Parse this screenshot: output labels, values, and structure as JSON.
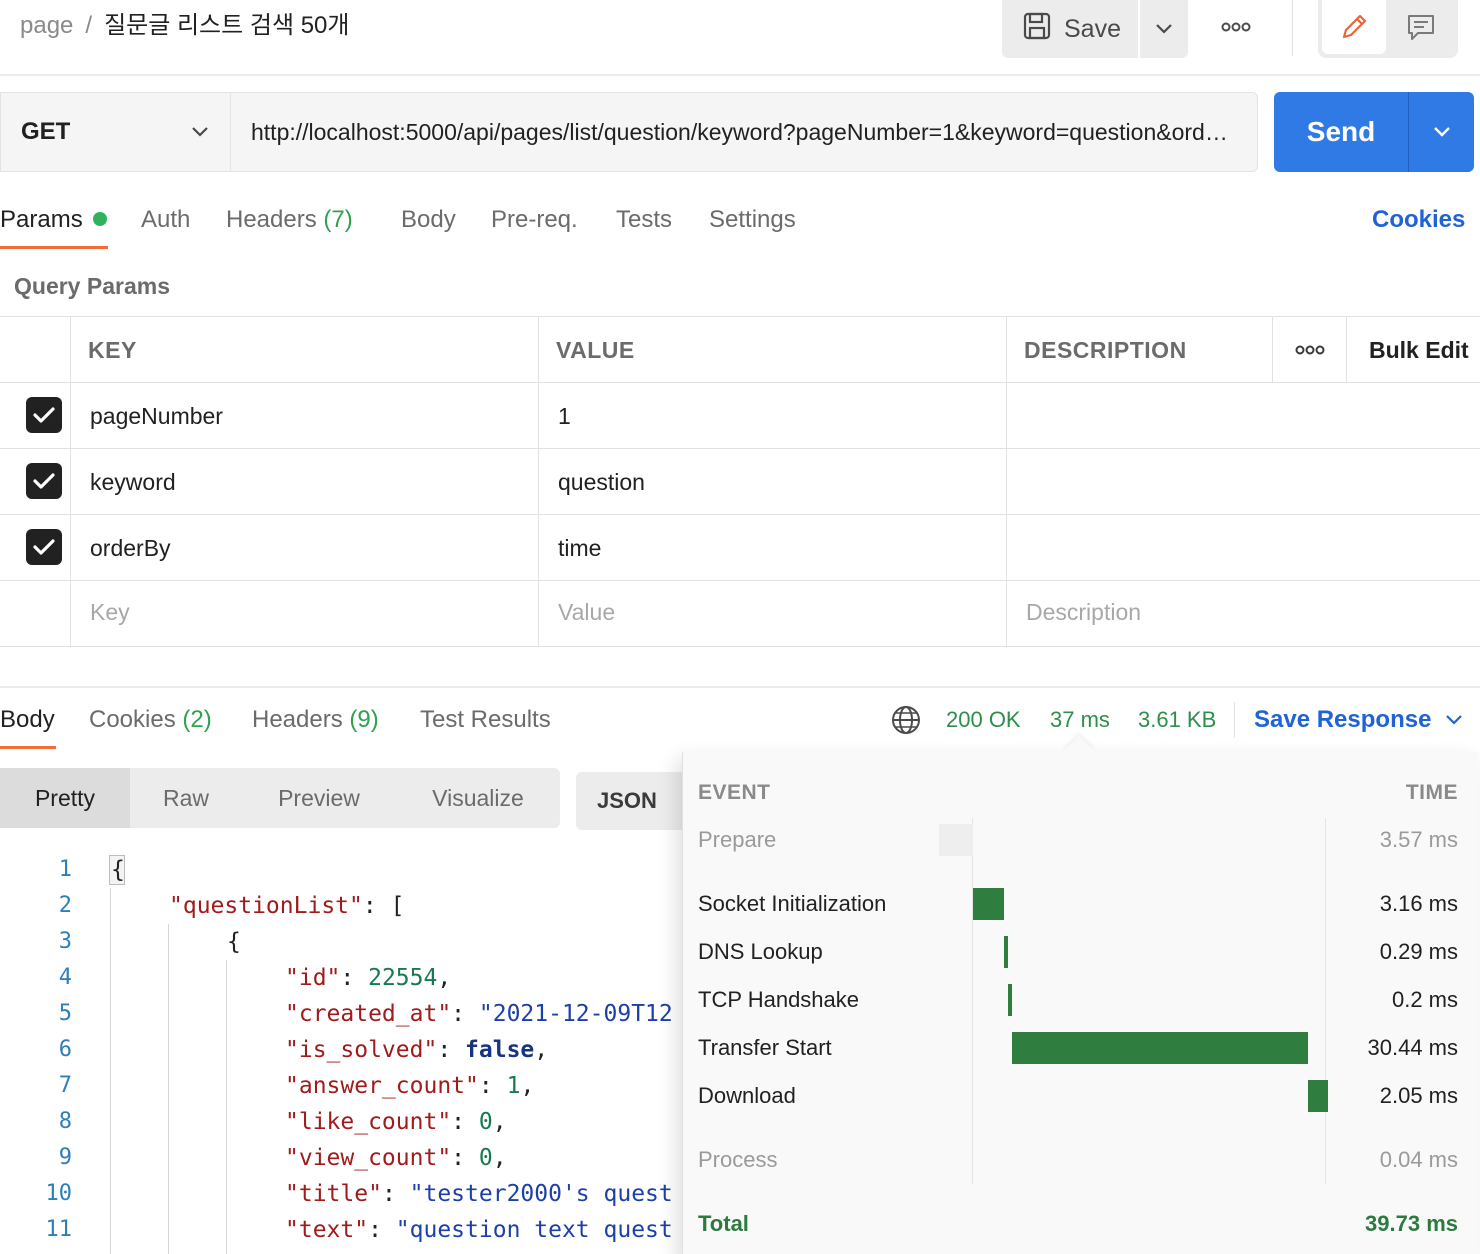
{
  "breadcrumb": {
    "parent": "page",
    "separator": "/",
    "title": "질문글 리스트 검색 50개"
  },
  "toolbar": {
    "save_label": "Save",
    "save_icon": "save-icon",
    "more_icon": "ellipsis-icon",
    "edit_icon": "pencil-icon",
    "comment_icon": "comment-icon"
  },
  "request": {
    "method": "GET",
    "url": "http://localhost:5000/api/pages/list/question/keyword?pageNumber=1&keyword=question&orderBy=time",
    "send_label": "Send"
  },
  "request_tabs": [
    {
      "label": "Params",
      "count": "",
      "active": true,
      "dot": true
    },
    {
      "label": "Auth",
      "count": ""
    },
    {
      "label": "Headers",
      "count": "(7)"
    },
    {
      "label": "Body",
      "count": ""
    },
    {
      "label": "Pre-req.",
      "count": ""
    },
    {
      "label": "Tests",
      "count": ""
    },
    {
      "label": "Settings",
      "count": ""
    }
  ],
  "cookies_link": "Cookies",
  "query_params": {
    "label": "Query Params",
    "columns": {
      "key": "KEY",
      "value": "VALUE",
      "description": "DESCRIPTION",
      "bulk_edit": "Bulk Edit"
    },
    "rows": [
      {
        "checked": true,
        "key": "pageNumber",
        "value": "1",
        "description": ""
      },
      {
        "checked": true,
        "key": "keyword",
        "value": "question",
        "description": ""
      },
      {
        "checked": true,
        "key": "orderBy",
        "value": "time",
        "description": ""
      }
    ],
    "placeholders": {
      "key": "Key",
      "value": "Value",
      "description": "Description"
    }
  },
  "response_tabs": [
    {
      "label": "Body",
      "count": "",
      "active": true
    },
    {
      "label": "Cookies",
      "count": "(2)"
    },
    {
      "label": "Headers",
      "count": "(9)"
    },
    {
      "label": "Test Results",
      "count": ""
    }
  ],
  "response_status": {
    "status": "200 OK",
    "time": "37 ms",
    "size": "3.61 KB",
    "save_response": "Save Response"
  },
  "format_buttons": [
    "Pretty",
    "Raw",
    "Preview",
    "Visualize"
  ],
  "format_active": "Pretty",
  "format_type": "JSON",
  "code_lines": [
    {
      "n": "1"
    },
    {
      "n": "2"
    },
    {
      "n": "3"
    },
    {
      "n": "4"
    },
    {
      "n": "5"
    },
    {
      "n": "6"
    },
    {
      "n": "7"
    },
    {
      "n": "8"
    },
    {
      "n": "9"
    },
    {
      "n": "10"
    },
    {
      "n": "11"
    }
  ],
  "code": {
    "l1": "{",
    "l2_key": "\"questionList\"",
    "l2_rest": ": [",
    "l3": "{",
    "l4_key": "\"id\"",
    "l4_val": "22554",
    "l5_key": "\"created_at\"",
    "l5_val": "\"2021-12-09T12",
    "l6_key": "\"is_solved\"",
    "l6_val": "false",
    "l7_key": "\"answer_count\"",
    "l7_val": "1",
    "l8_key": "\"like_count\"",
    "l8_val": "0",
    "l9_key": "\"view_count\"",
    "l9_val": "0",
    "l10_key": "\"title\"",
    "l10_val": "\"tester2000's quest",
    "l11_key": "\"text\"",
    "l11_val": "\"question text quest"
  },
  "timing": {
    "header_event": "EVENT",
    "header_time": "TIME",
    "prepare": {
      "label": "Prepare",
      "time": "3.57 ms",
      "ms": 3.57
    },
    "events": [
      {
        "label": "Socket Initialization",
        "time": "3.16 ms",
        "ms": 3.16
      },
      {
        "label": "DNS Lookup",
        "time": "0.29 ms",
        "ms": 0.29
      },
      {
        "label": "TCP Handshake",
        "time": "0.2 ms",
        "ms": 0.2
      },
      {
        "label": "Transfer Start",
        "time": "30.44 ms",
        "ms": 30.44
      },
      {
        "label": "Download",
        "time": "2.05 ms",
        "ms": 2.05
      }
    ],
    "process": {
      "label": "Process",
      "time": "0.04 ms",
      "ms": 0.04
    },
    "total_label": "Total",
    "total_time": "39.73 ms",
    "bar_color": "#2f7d3f"
  },
  "colors": {
    "accent": "#2f7ae4",
    "tab_underline": "#f26b3a",
    "success": "#30a14e",
    "link": "#1f63d4"
  }
}
